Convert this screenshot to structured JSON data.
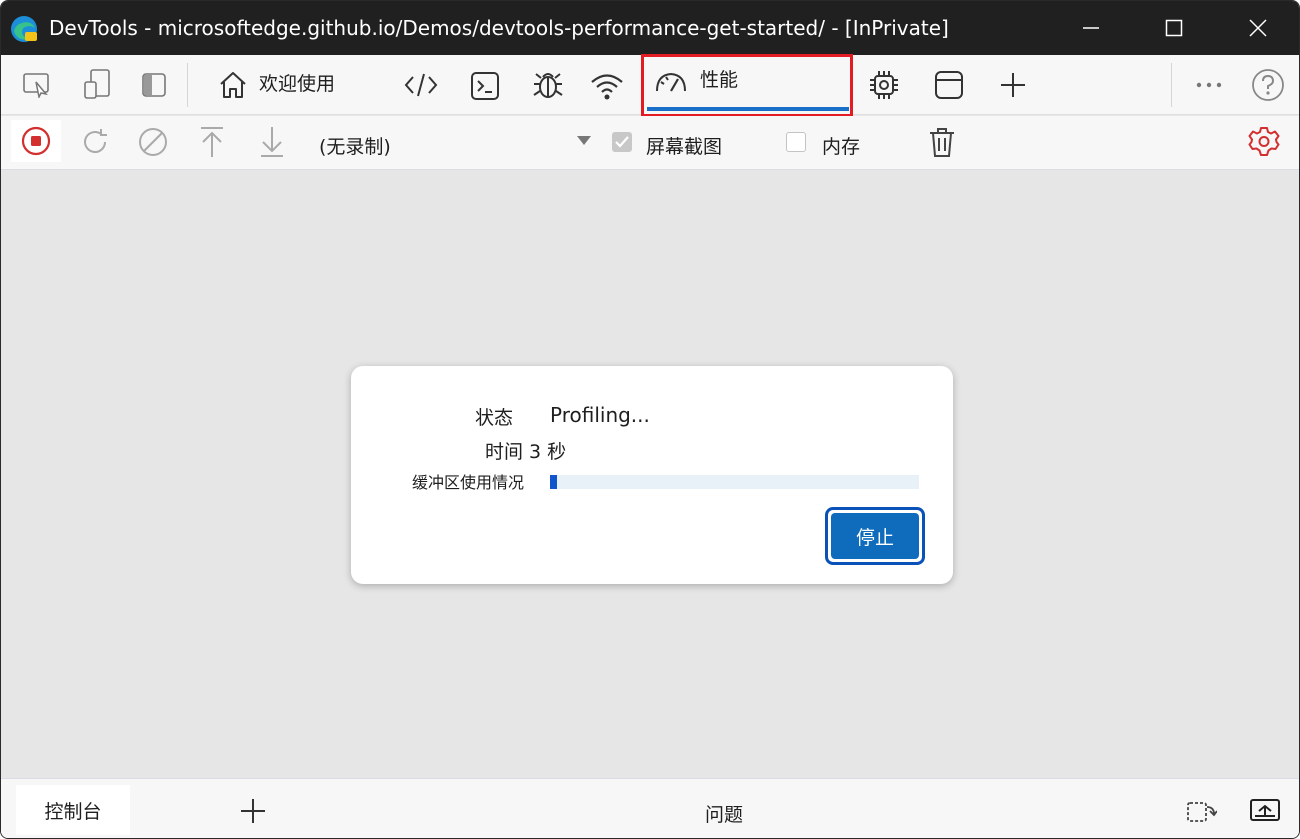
{
  "window": {
    "title": "DevTools - microsoftedge.github.io/Demos/devtools-performance-get-started/ - [InPrivate]"
  },
  "tabs": {
    "welcome_label": "欢迎使用",
    "performance_label": "性能"
  },
  "perf_toolbar": {
    "recording_select": "(无录制)",
    "screenshots_label": "屏幕截图",
    "screenshots_checked": true,
    "memory_label": "内存",
    "memory_checked": false
  },
  "dialog": {
    "status_label": "状态",
    "status_value": "Profiling...",
    "time_text": "时间 3 秒",
    "buffer_label": "缓冲区使用情况",
    "buffer_fraction": 0.02,
    "stop_label": "停止"
  },
  "drawer": {
    "console_tab": "控制台",
    "issues_label": "问题"
  },
  "colors": {
    "accent": "#0f6cbd",
    "record_red": "#d32f2f",
    "highlight_red": "#e31b23",
    "titlebar": "#202020"
  }
}
